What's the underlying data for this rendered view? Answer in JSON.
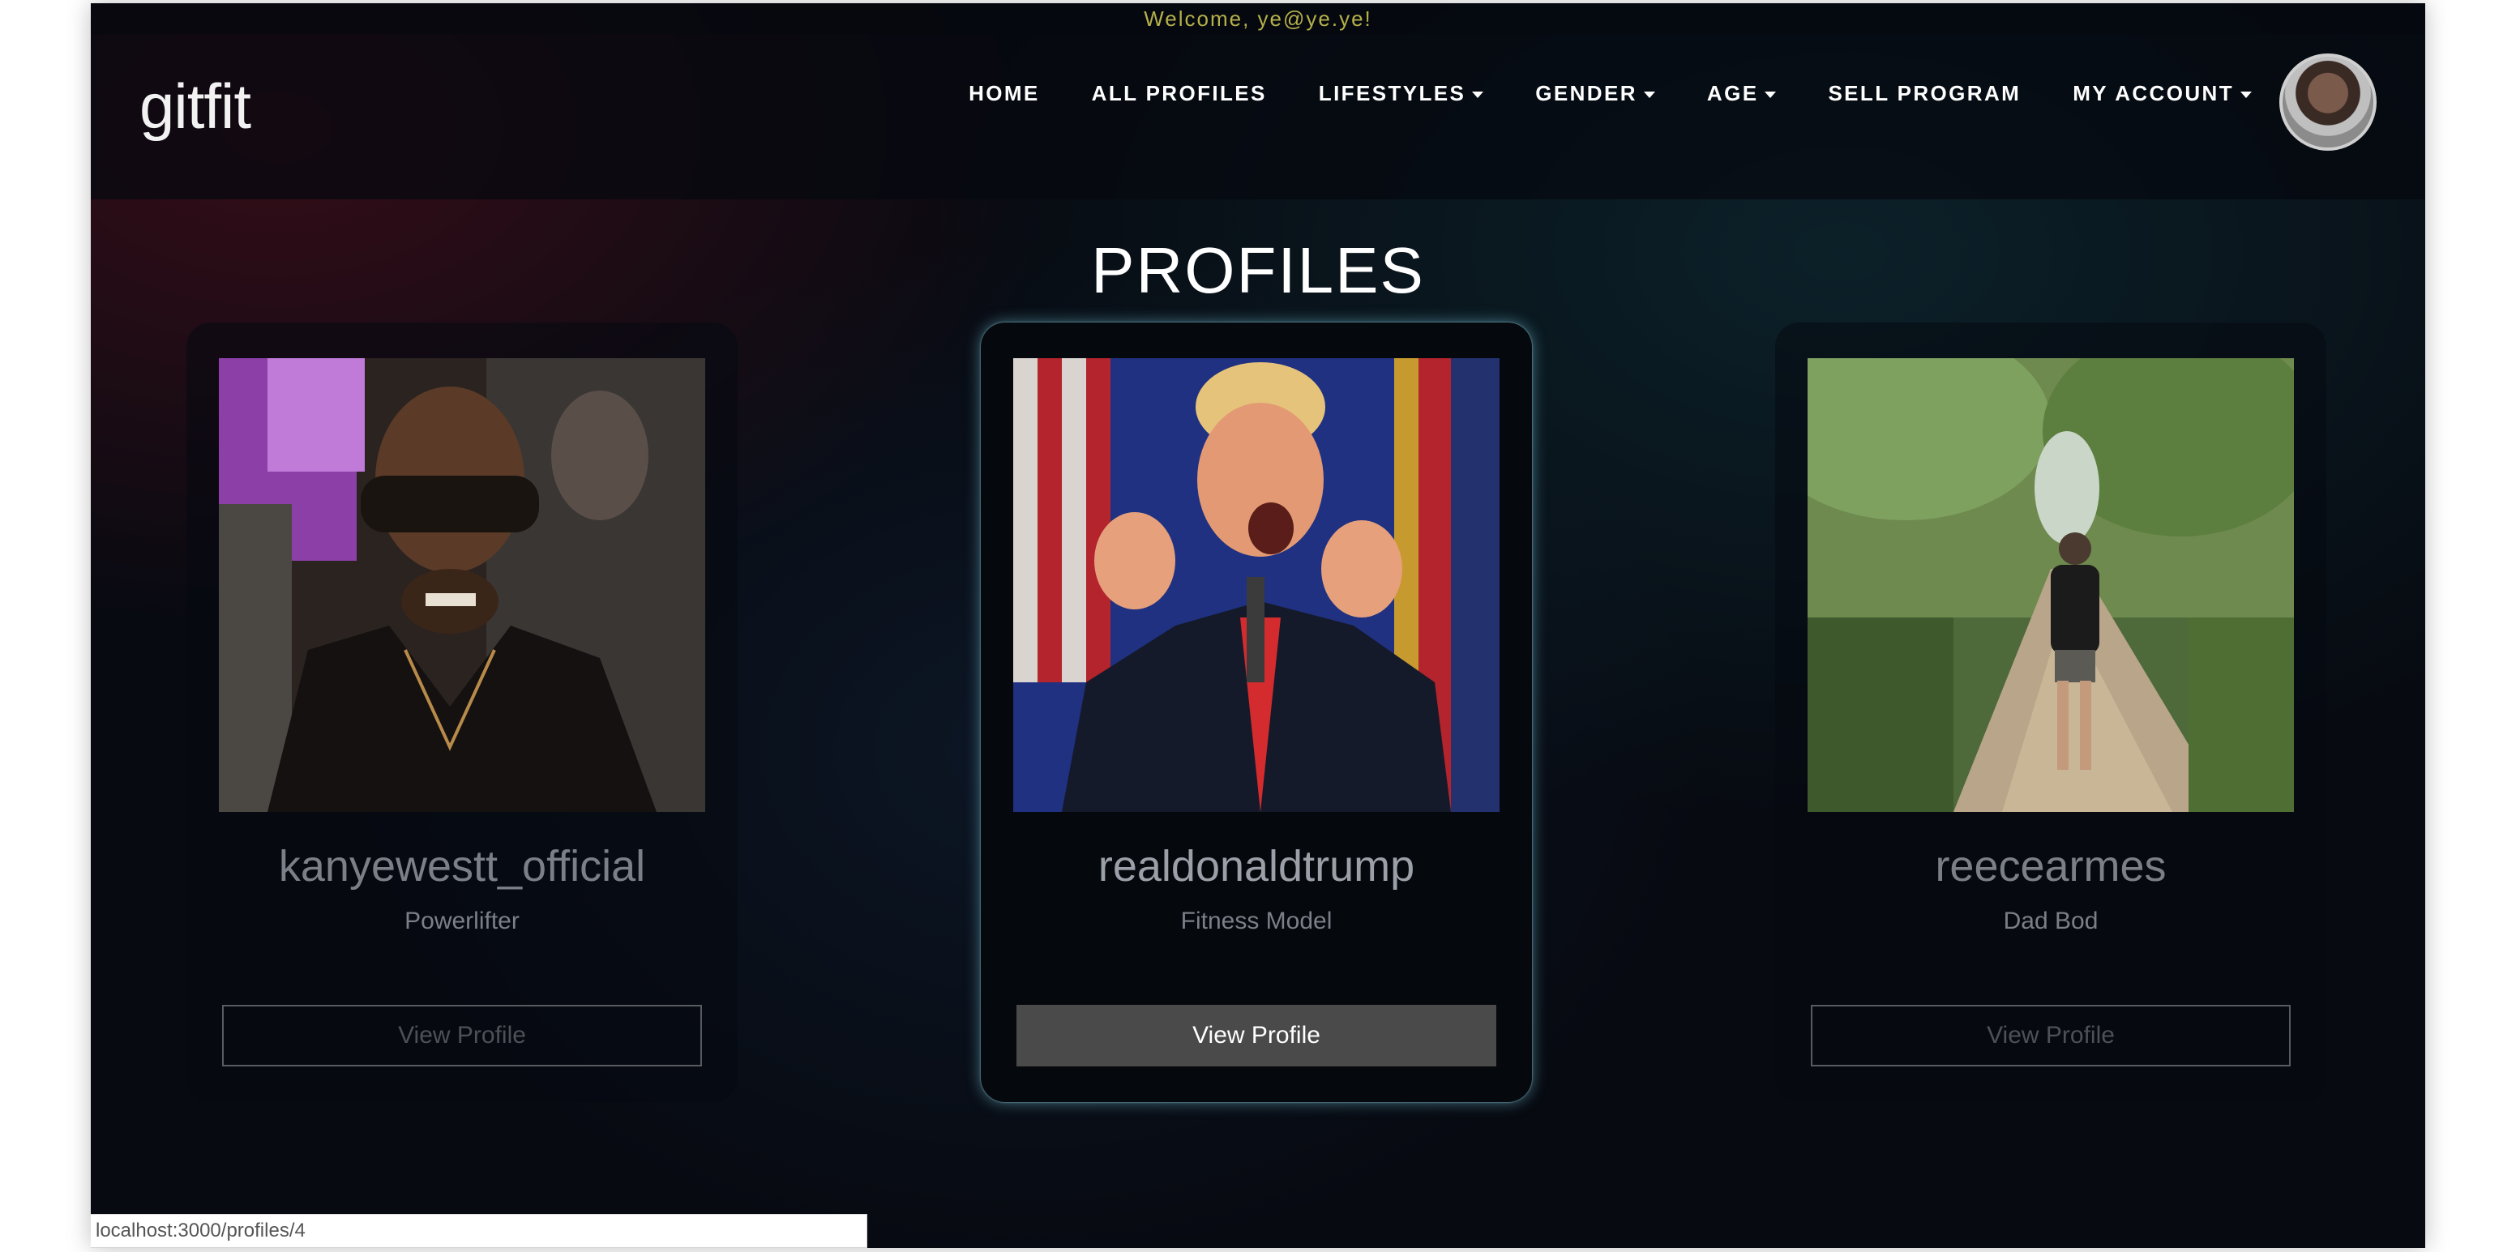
{
  "welcome_text": "Welcome, ye@ye.ye!",
  "brand": "gitfit",
  "nav": {
    "items": [
      {
        "label": "HOME",
        "dropdown": false
      },
      {
        "label": "ALL PROFILES",
        "dropdown": false
      },
      {
        "label": "LIFESTYLES",
        "dropdown": true
      },
      {
        "label": "GENDER",
        "dropdown": true
      },
      {
        "label": "AGE",
        "dropdown": true
      },
      {
        "label": "SELL PROGRAM",
        "dropdown": false
      },
      {
        "label": "MY ACCOUNT",
        "dropdown": true
      }
    ]
  },
  "page_title": "PROFILES",
  "profiles": [
    {
      "name": "kanyewestt_official",
      "lifestyle": "Powerlifter",
      "button": "View Profile",
      "highlighted": false
    },
    {
      "name": "realdonaldtrump",
      "lifestyle": "Fitness Model",
      "button": "View Profile",
      "highlighted": true
    },
    {
      "name": "reecearmes",
      "lifestyle": "Dad Bod",
      "button": "View Profile",
      "highlighted": false
    }
  ],
  "status_url": "localhost:3000/profiles/4",
  "colors": {
    "background": "#070a11",
    "welcome_text": "#b5b04a",
    "active_button": "#4a4a4a",
    "card_glow": "#78c8dc"
  }
}
